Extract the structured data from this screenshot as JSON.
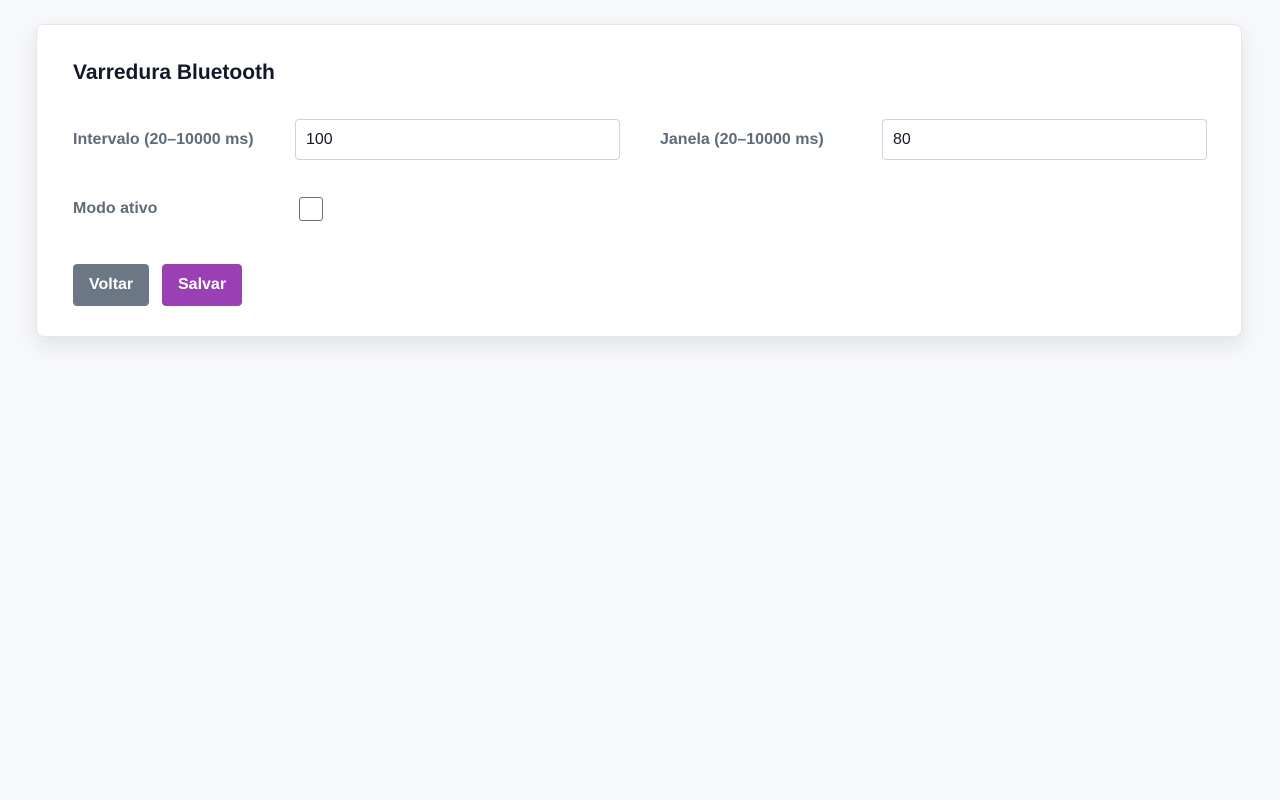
{
  "panel": {
    "title": "Varredura Bluetooth"
  },
  "form": {
    "interval": {
      "label": "Intervalo (20–10000 ms)",
      "value": "100"
    },
    "window": {
      "label": "Janela (20–10000 ms)",
      "value": "80"
    },
    "active_mode": {
      "label": "Modo ativo",
      "checked": false
    }
  },
  "actions": {
    "back_label": "Voltar",
    "save_label": "Salvar"
  },
  "colors": {
    "accent": "#9b3fb5",
    "secondary": "#6b7785"
  }
}
